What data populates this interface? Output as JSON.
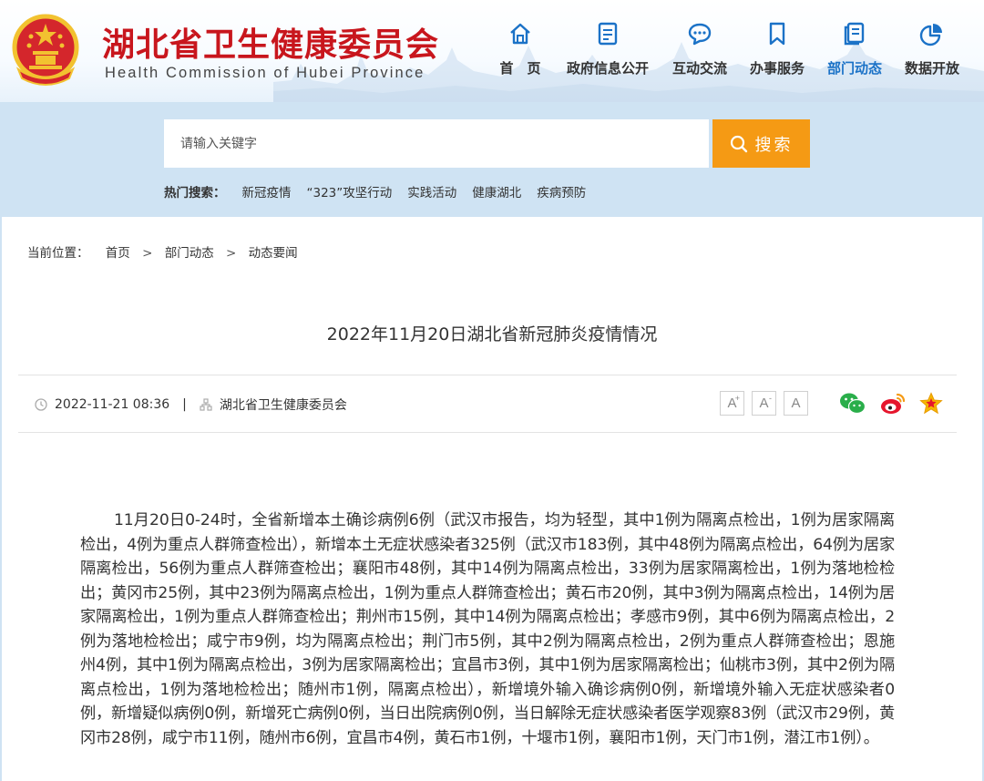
{
  "header": {
    "title": "湖北省卫生健康委员会",
    "subtitle": "Health Commission of Hubei Province",
    "nav": [
      {
        "label": "首　页",
        "icon": "home-icon"
      },
      {
        "label": "政府信息公开",
        "icon": "document-icon"
      },
      {
        "label": "互动交流",
        "icon": "chat-icon"
      },
      {
        "label": "办事服务",
        "icon": "bookmark-icon"
      },
      {
        "label": "部门动态",
        "icon": "news-icon",
        "active": true
      },
      {
        "label": "数据开放",
        "icon": "pie-chart-icon"
      }
    ],
    "accent_color": "#c8161d",
    "active_color": "#1b72c7"
  },
  "search": {
    "placeholder": "请输入关键字",
    "button_label": "搜索",
    "hot_label": "热门搜索：",
    "hot_links": [
      "新冠疫情",
      "“323”攻坚行动",
      "实践活动",
      "健康湖北",
      "疾病预防"
    ],
    "button_color": "#f59a14"
  },
  "breadcrumb": {
    "prefix": "当前位置：",
    "items": [
      "首页",
      "部门动态",
      "动态要闻"
    ]
  },
  "article": {
    "title": "2022年11月20日湖北省新冠肺炎疫情情况",
    "date": "2022-11-21 08:36",
    "separator": "|",
    "source": "湖北省卫生健康委员会",
    "font_buttons": [
      "A",
      "A",
      "A"
    ],
    "body": "11月20日0-24时，全省新增本土确诊病例6例（武汉市报告，均为轻型，其中1例为隔离点检出，1例为居家隔离检出，4例为重点人群筛查检出），新增本土无症状感染者325例（武汉市183例，其中48例为隔离点检出，64例为居家隔离检出，56例为重点人群筛查检出；襄阳市48例，其中14例为隔离点检出，33例为居家隔离检出，1例为落地检检出；黄冈市25例，其中23例为隔离点检出，1例为重点人群筛查检出；黄石市20例，其中3例为隔离点检出，14例为居家隔离检出，1例为重点人群筛查检出；荆州市15例，其中14例为隔离点检出；孝感市9例，其中6例为隔离点检出，2例为落地检检出；咸宁市9例，均为隔离点检出；荆门市5例，其中2例为隔离点检出，2例为重点人群筛查检出；恩施州4例，其中1例为隔离点检出，3例为居家隔离检出；宜昌市3例，其中1例为居家隔离检出；仙桃市3例，其中2例为隔离点检出，1例为落地检检出；随州市1例，隔离点检出），新增境外输入确诊病例0例，新增境外输入无症状感染者0例，新增疑似病例0例，新增死亡病例0例，当日出院病例0例，当日解除无症状感染者医学观察83例（武汉市29例，黄冈市28例，咸宁市11例，随州市6例，宜昌市4例，黄石市1例，十堰市1例，襄阳市1例，天门市1例，潜江市1例）。"
  }
}
